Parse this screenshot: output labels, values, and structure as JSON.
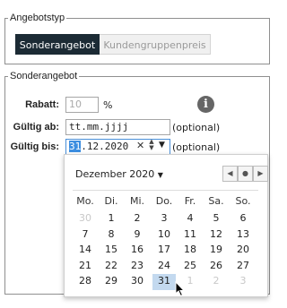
{
  "offer_type": {
    "legend": "Angebotstyp",
    "tabs": [
      {
        "label": "Sonderangebot",
        "selected": true
      },
      {
        "label": "Kundengruppenpreis",
        "selected": false
      }
    ]
  },
  "special_offer": {
    "legend": "Sonderangebot",
    "discount": {
      "label": "Rabatt:",
      "placeholder": "10",
      "unit": "%"
    },
    "valid_from": {
      "label": "Gültig ab:",
      "value": "tt.mm.jjjj",
      "note": "(optional)"
    },
    "valid_to": {
      "label": "Gültig bis:",
      "day": "31",
      "rest": ".12.2020",
      "note": "(optional)"
    },
    "info_icon": "i"
  },
  "calendar": {
    "month_label": "Dezember 2020",
    "weekdays": [
      "Mo.",
      "Di.",
      "Mi.",
      "Do.",
      "Fr.",
      "Sa.",
      "So."
    ],
    "weeks": [
      [
        "30",
        "1",
        "2",
        "3",
        "4",
        "5",
        "6"
      ],
      [
        "7",
        "8",
        "9",
        "10",
        "11",
        "12",
        "13"
      ],
      [
        "14",
        "15",
        "16",
        "17",
        "18",
        "19",
        "20"
      ],
      [
        "21",
        "22",
        "23",
        "24",
        "25",
        "26",
        "27"
      ],
      [
        "28",
        "29",
        "30",
        "31",
        "1",
        "2",
        "3"
      ]
    ],
    "selected": "31"
  }
}
